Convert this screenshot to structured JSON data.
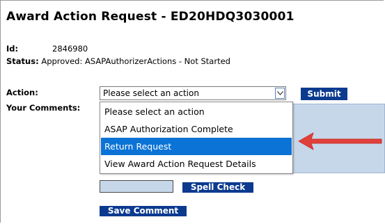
{
  "page": {
    "title": "Award Action Request - ED20HDQ3030001"
  },
  "details": {
    "id_label": "Id:",
    "id_value": "2846980",
    "status_label": "Status:",
    "status_value": "Approved: ASAPAuthorizerActions - Not Started"
  },
  "form": {
    "action_label": "Action:",
    "comments_label": "Your Comments:",
    "action_select": {
      "selected": "Please select an action",
      "options": [
        "Please select an action",
        "ASAP Authorization Complete",
        "Return Request",
        "View Award Action Request Details"
      ],
      "highlighted_index": 2
    },
    "submit_label": "Submit",
    "spell_check_label": "Spell Check",
    "save_comment_label": "Save Comment"
  },
  "annotation": {
    "arrow_color": "#e0413a",
    "arrow_icon": "left-arrow-icon"
  },
  "colors": {
    "button_bg": "#0b3a8f",
    "highlight": "#0b73d6",
    "comment_bg": "#c7d7ea"
  }
}
